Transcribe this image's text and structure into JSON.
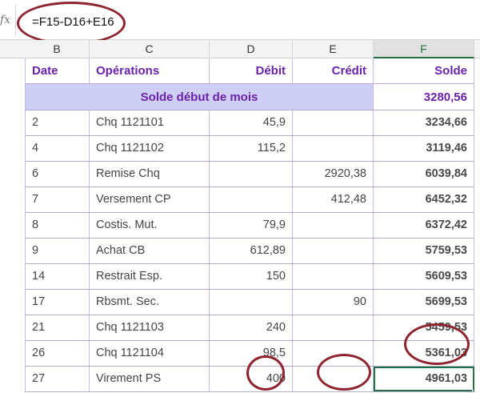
{
  "formula_bar": {
    "fx": "fx",
    "formula": "=F15-D16+E16"
  },
  "column_headers": [
    "B",
    "C",
    "D",
    "E",
    "F"
  ],
  "active_column": "F",
  "table": {
    "headers": [
      "Date",
      "Opérations",
      "Débit",
      "Crédit",
      "Solde"
    ],
    "opening_label": "Solde début de mois",
    "opening_balance": "3280,56",
    "rows": [
      {
        "date": "2",
        "op": "Chq 1121101",
        "debit": "45,9",
        "credit": "",
        "balance": "3234,66"
      },
      {
        "date": "4",
        "op": "Chq 1121102",
        "debit": "115,2",
        "credit": "",
        "balance": "3119,46"
      },
      {
        "date": "6",
        "op": "Remise Chq",
        "debit": "",
        "credit": "2920,38",
        "balance": "6039,84"
      },
      {
        "date": "7",
        "op": "Versement CP",
        "debit": "",
        "credit": "412,48",
        "balance": "6452,32"
      },
      {
        "date": "8",
        "op": "Costis. Mut.",
        "debit": "79,9",
        "credit": "",
        "balance": "6372,42"
      },
      {
        "date": "9",
        "op": "Achat CB",
        "debit": "612,89",
        "credit": "",
        "balance": "5759,53"
      },
      {
        "date": "14",
        "op": "Restrait Esp.",
        "debit": "150",
        "credit": "",
        "balance": "5609,53"
      },
      {
        "date": "17",
        "op": "Rbsmt. Sec.",
        "debit": "",
        "credit": "90",
        "balance": "5699,53"
      },
      {
        "date": "21",
        "op": "Chq 1121103",
        "debit": "240",
        "credit": "",
        "balance": "5459,53"
      },
      {
        "date": "26",
        "op": "Chq 1121104",
        "debit": "98,5",
        "credit": "",
        "balance": "5361,03"
      },
      {
        "date": "27",
        "op": "Virement PS",
        "debit": "400",
        "credit": "",
        "balance": "4961,03"
      }
    ]
  },
  "colors": {
    "accent": "#6a22a8",
    "band": "#cfcff5",
    "annotation": "#8e2430",
    "selection": "#217346"
  }
}
